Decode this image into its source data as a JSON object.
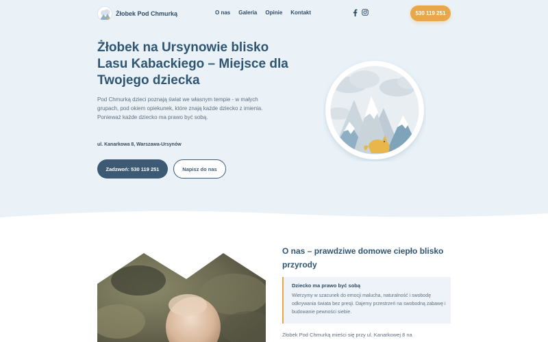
{
  "header": {
    "logo_text": "Żłobek Pod Chmurką",
    "nav": [
      "O nas",
      "Galeria",
      "Opinie",
      "Kontakt"
    ],
    "social": [
      {
        "icon": "facebook-icon"
      },
      {
        "icon": "instagram-icon"
      }
    ],
    "phone_button": "530 119 251"
  },
  "hero": {
    "title": "Żłobek na Ursynowie blisko Lasu Kabackiego – Miejsce dla Twojego dziecka",
    "text": "Pod Chmurką dzieci poznają świat we własnym tempie - w małych grupach, pod okiem opiekunek, które znają każde dziecko z imienia. Ponieważ każde dziecko ma prawo być sobą.",
    "address": "ul. Kanarkowa 8, Warszawa-Ursynów",
    "primary_button": "Zadzwoń: 530 119 251",
    "secondary_button": "Napisz do nas"
  },
  "about": {
    "title": "O nas – prawdziwe domowe ciepło blisko przyrody",
    "quote_title": "Dziecko ma prawo być sobą",
    "quote_text": "Wierzymy w szacunek do emocji malucha, naturalność i swobodę odkrywania świata bez presji. Dajemy przestrzeń na swobodną zabawę i budowanie pewności siebie.",
    "text": "Żłobek Pod Chmurką mieści się przy ul. Kanarkowej 8 na"
  },
  "colors": {
    "accent": "#e8a84a",
    "primary": "#3c5a74",
    "hero_bg": "#eaf2f8"
  }
}
